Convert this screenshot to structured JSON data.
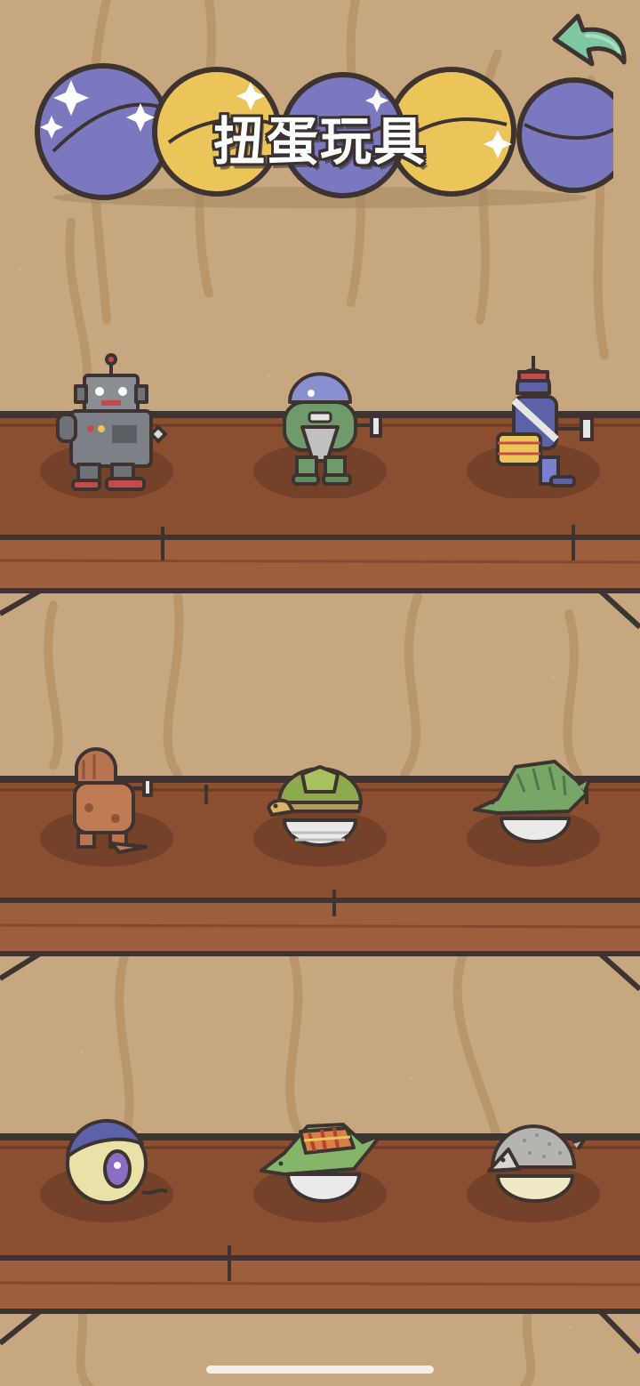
{
  "screen": {
    "title": "扭蛋玩具",
    "back_icon": "back-arrow-icon",
    "colors": {
      "wall": "#c6a77f",
      "shelf_top": "#8a4f31",
      "shelf_front": "#9c5e3d",
      "outline": "#3d3331",
      "capsule_purple": "#7a79c0",
      "capsule_yellow": "#ebc45a",
      "back_arrow": "#7fc7a2"
    }
  },
  "shelves": [
    {
      "items": [
        {
          "name": "tin-robot",
          "icon": "tin-robot-icon"
        },
        {
          "name": "green-dome-robot",
          "icon": "dome-robot-icon"
        },
        {
          "name": "drummer-soldier",
          "icon": "drummer-toy-icon"
        }
      ]
    },
    {
      "items": [
        {
          "name": "rust-robot-bird",
          "icon": "rust-robot-icon"
        },
        {
          "name": "tortoise",
          "icon": "tortoise-icon"
        },
        {
          "name": "armored-fish",
          "icon": "armored-fish-icon"
        }
      ]
    },
    {
      "items": [
        {
          "name": "purple-eye-creature",
          "icon": "eye-creature-icon"
        },
        {
          "name": "striped-chameleon",
          "icon": "chameleon-icon"
        },
        {
          "name": "grey-hedgehog",
          "icon": "hedgehog-icon"
        }
      ]
    }
  ]
}
